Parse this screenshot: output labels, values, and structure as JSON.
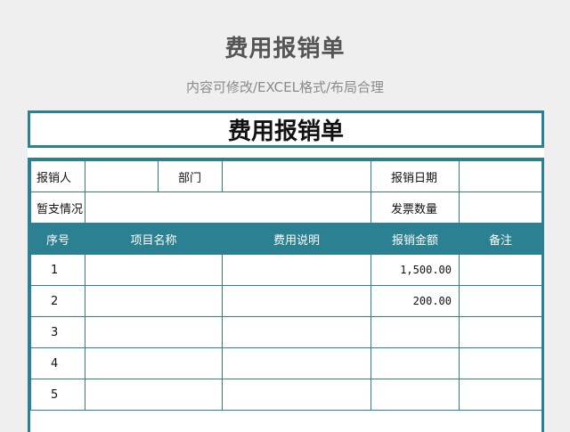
{
  "page": {
    "title": "费用报销单",
    "subtitle": "内容可修改/EXCEL格式/布局合理"
  },
  "form": {
    "title": "费用报销单",
    "labels": {
      "reimburser": "报销人",
      "department": "部门",
      "reimburse_date": "报销日期",
      "advance_status": "暂支情况",
      "invoice_count": "发票数量"
    },
    "columns": [
      "序号",
      "项目名称",
      "费用说明",
      "报销金额",
      "备注"
    ],
    "rows": [
      {
        "no": "1",
        "item": "",
        "desc": "",
        "amount": "1,500.00",
        "note": ""
      },
      {
        "no": "2",
        "item": "",
        "desc": "",
        "amount": "200.00",
        "note": ""
      },
      {
        "no": "3",
        "item": "",
        "desc": "",
        "amount": "",
        "note": ""
      },
      {
        "no": "4",
        "item": "",
        "desc": "",
        "amount": "",
        "note": ""
      },
      {
        "no": "5",
        "item": "",
        "desc": "",
        "amount": "",
        "note": ""
      }
    ]
  },
  "colors": {
    "accent": "#2b8091",
    "background": "#efefef"
  }
}
